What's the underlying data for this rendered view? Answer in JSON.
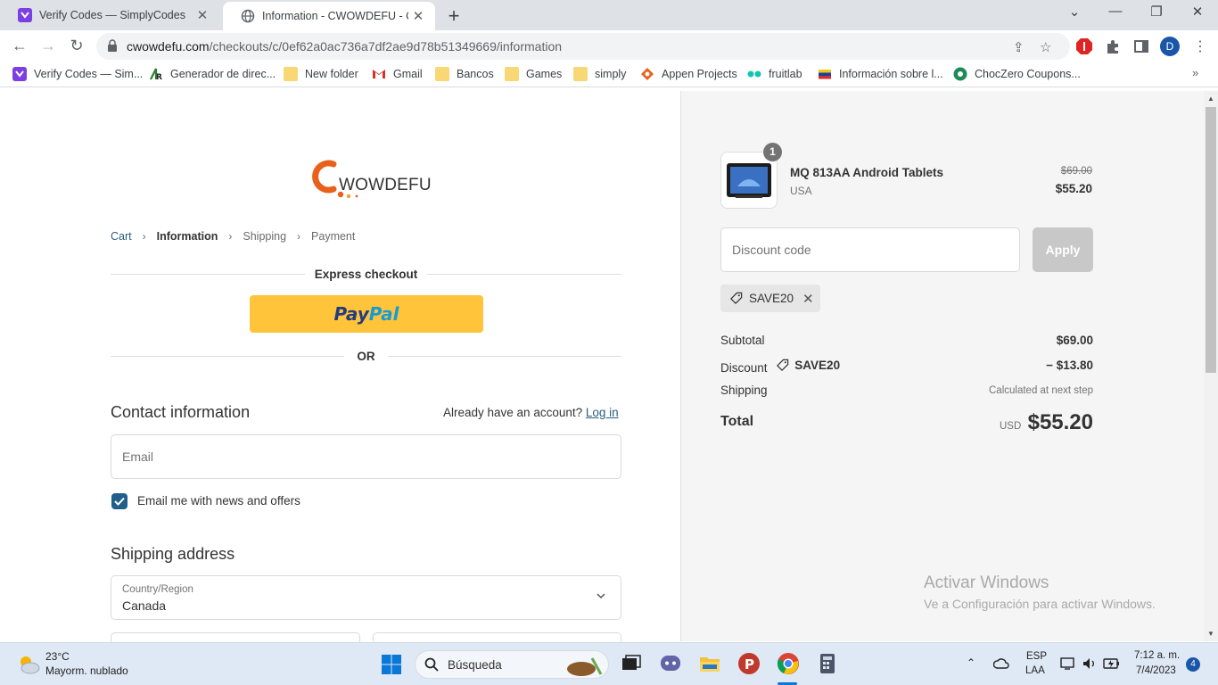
{
  "browser": {
    "tabs": [
      {
        "title": "Verify Codes — SimplyCodes",
        "active": false
      },
      {
        "title": "Information - CWOWDEFU - Che",
        "active": true
      }
    ],
    "url_host": "cwowdefu.com",
    "url_path": "/checkouts/c/0ef62a0ac736a7df2ae9d78b51349669/information",
    "profile_initial": "D",
    "bookmarks": [
      {
        "label": "Verify Codes — Sim...",
        "icon": "simplycodes-icon"
      },
      {
        "label": "Generador de direc...",
        "icon": "generator-icon"
      },
      {
        "label": "New folder",
        "icon": "folder-icon"
      },
      {
        "label": "Gmail",
        "icon": "gmail-icon"
      },
      {
        "label": "Bancos",
        "icon": "folder-icon"
      },
      {
        "label": "Games",
        "icon": "folder-icon"
      },
      {
        "label": "simply",
        "icon": "folder-icon"
      },
      {
        "label": "Appen Projects",
        "icon": "appen-icon"
      },
      {
        "label": "fruitlab",
        "icon": "fruitlab-icon"
      },
      {
        "label": "Información sobre l...",
        "icon": "flag-icon"
      },
      {
        "label": "ChocZero Coupons...",
        "icon": "choczero-icon"
      }
    ]
  },
  "checkout": {
    "logo_text": "WOWDEFU",
    "breadcrumb": {
      "cart": "Cart",
      "information": "Information",
      "shipping": "Shipping",
      "payment": "Payment"
    },
    "express_checkout": "Express checkout",
    "paypal_pay": "Pay",
    "paypal_pal": "Pal",
    "or": "OR",
    "contact_heading": "Contact information",
    "have_account": "Already have an account?",
    "login_link": "Log in",
    "email_placeholder": "Email",
    "email_optin": "Email me with news and offers",
    "email_optin_checked": true,
    "shipping_heading": "Shipping address",
    "country_label": "Country/Region",
    "country_value": "Canada"
  },
  "summary": {
    "product_name": "MQ 813AA Android Tablets",
    "product_variant": "USA",
    "quantity": "1",
    "price_original": "$69.00",
    "price_current": "$55.20",
    "discount_placeholder": "Discount code",
    "apply_label": "Apply",
    "applied_code": "SAVE20",
    "subtotal_label": "Subtotal",
    "subtotal_value": "$69.00",
    "discount_label": "Discount",
    "discount_code": "SAVE20",
    "discount_value": "− $13.80",
    "shipping_label": "Shipping",
    "shipping_value": "Calculated at next step",
    "total_label": "Total",
    "total_currency": "USD",
    "total_value": "$55.20"
  },
  "watermark": {
    "line1": "Activar Windows",
    "line2": "Ve a Configuración para activar Windows."
  },
  "taskbar": {
    "temperature": "23°C",
    "condition": "Mayorm. nublado",
    "search_label": "Búsqueda",
    "lang_top": "ESP",
    "lang_bottom": "LAA",
    "time": "7:12 a. m.",
    "date": "7/4/2023",
    "notifications": "4"
  },
  "colors": {
    "accent": "#1f5f8a",
    "paypal_yellow": "#ffc439",
    "logo_orange": "#e8601c",
    "summary_bg": "#f5f5f5"
  }
}
